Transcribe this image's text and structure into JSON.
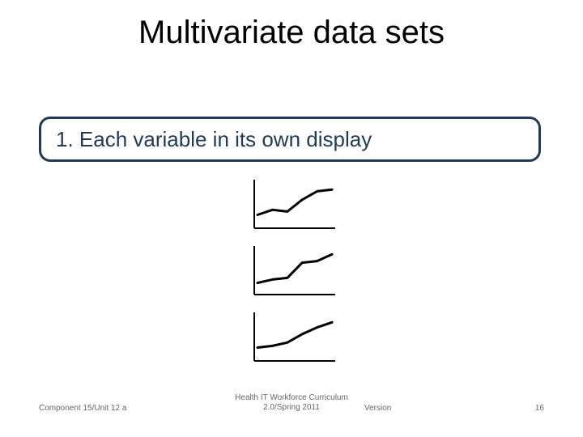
{
  "title": "Multivariate data sets",
  "callout": {
    "text": "1. Each variable in its own display"
  },
  "chart_data": [
    {
      "type": "line",
      "x": [
        0,
        1,
        2,
        3,
        4,
        5
      ],
      "values": [
        12,
        18,
        16,
        30,
        40,
        42
      ],
      "xlabel": "",
      "ylabel": "",
      "title": ""
    },
    {
      "type": "line",
      "x": [
        0,
        1,
        2,
        3,
        4,
        5
      ],
      "values": [
        10,
        14,
        16,
        34,
        36,
        44
      ],
      "xlabel": "",
      "ylabel": "",
      "title": ""
    },
    {
      "type": "line",
      "x": [
        0,
        1,
        2,
        3,
        4,
        5
      ],
      "values": [
        12,
        14,
        18,
        28,
        36,
        42
      ],
      "xlabel": "",
      "ylabel": "",
      "title": ""
    }
  ],
  "footer": {
    "left": "Component 15/Unit 12 a",
    "center_line1": "Health IT Workforce Curriculum",
    "center_line2": "2.0/Spring 2011",
    "version_label": "Version",
    "page": "16"
  }
}
